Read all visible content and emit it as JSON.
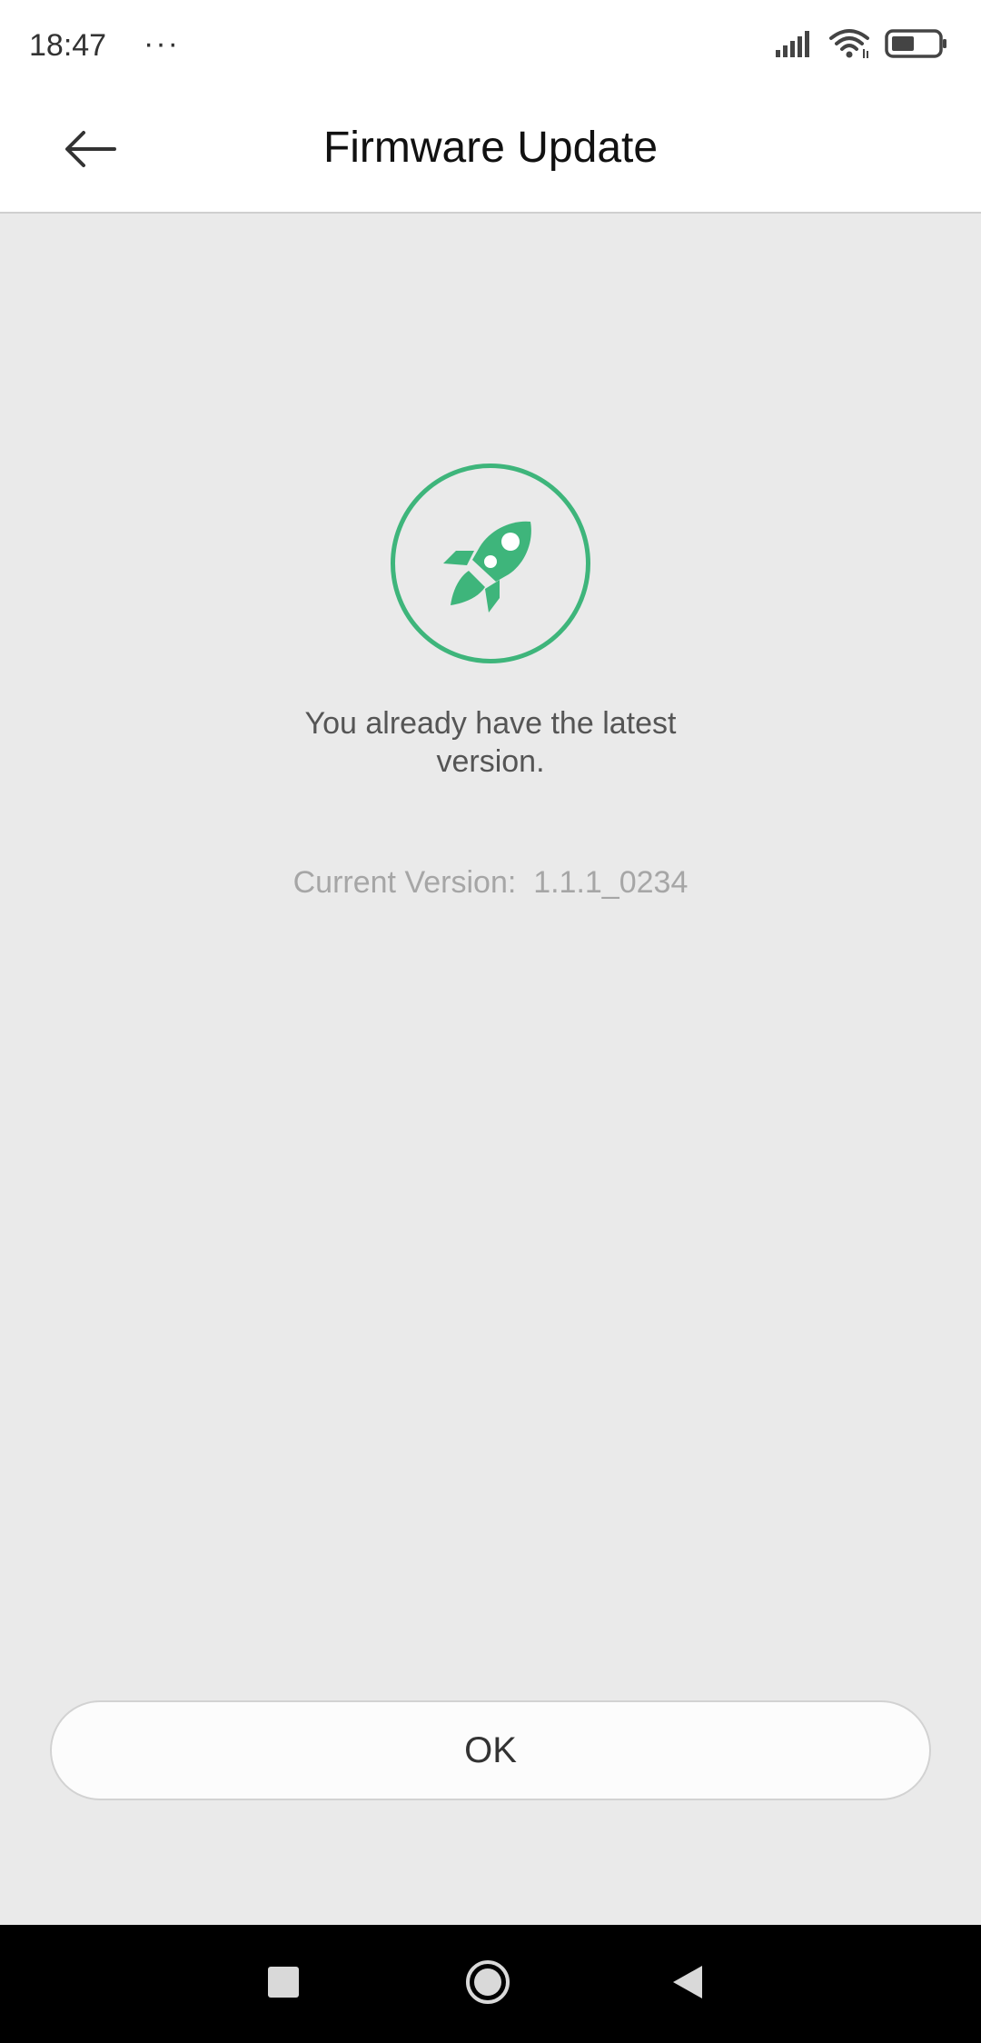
{
  "status_bar": {
    "time": "18:47",
    "more": "···",
    "icons": [
      "signal-icon",
      "wifi-icon",
      "battery-icon"
    ]
  },
  "header": {
    "title": "Firmware Update",
    "back_icon": "back-arrow-icon"
  },
  "main": {
    "icon": "rocket-icon",
    "message": "You already have the latest version.",
    "current_version": "Current Version:  1.1.1_0234"
  },
  "actions": {
    "ok_label": "OK"
  },
  "nav_bar": {
    "icons": [
      "recent-apps-icon",
      "home-icon",
      "back-icon"
    ]
  },
  "colors": {
    "accent": "#3eb57b",
    "background": "#eaeaea",
    "header_background": "#ffffff",
    "nav_background": "#000000"
  }
}
